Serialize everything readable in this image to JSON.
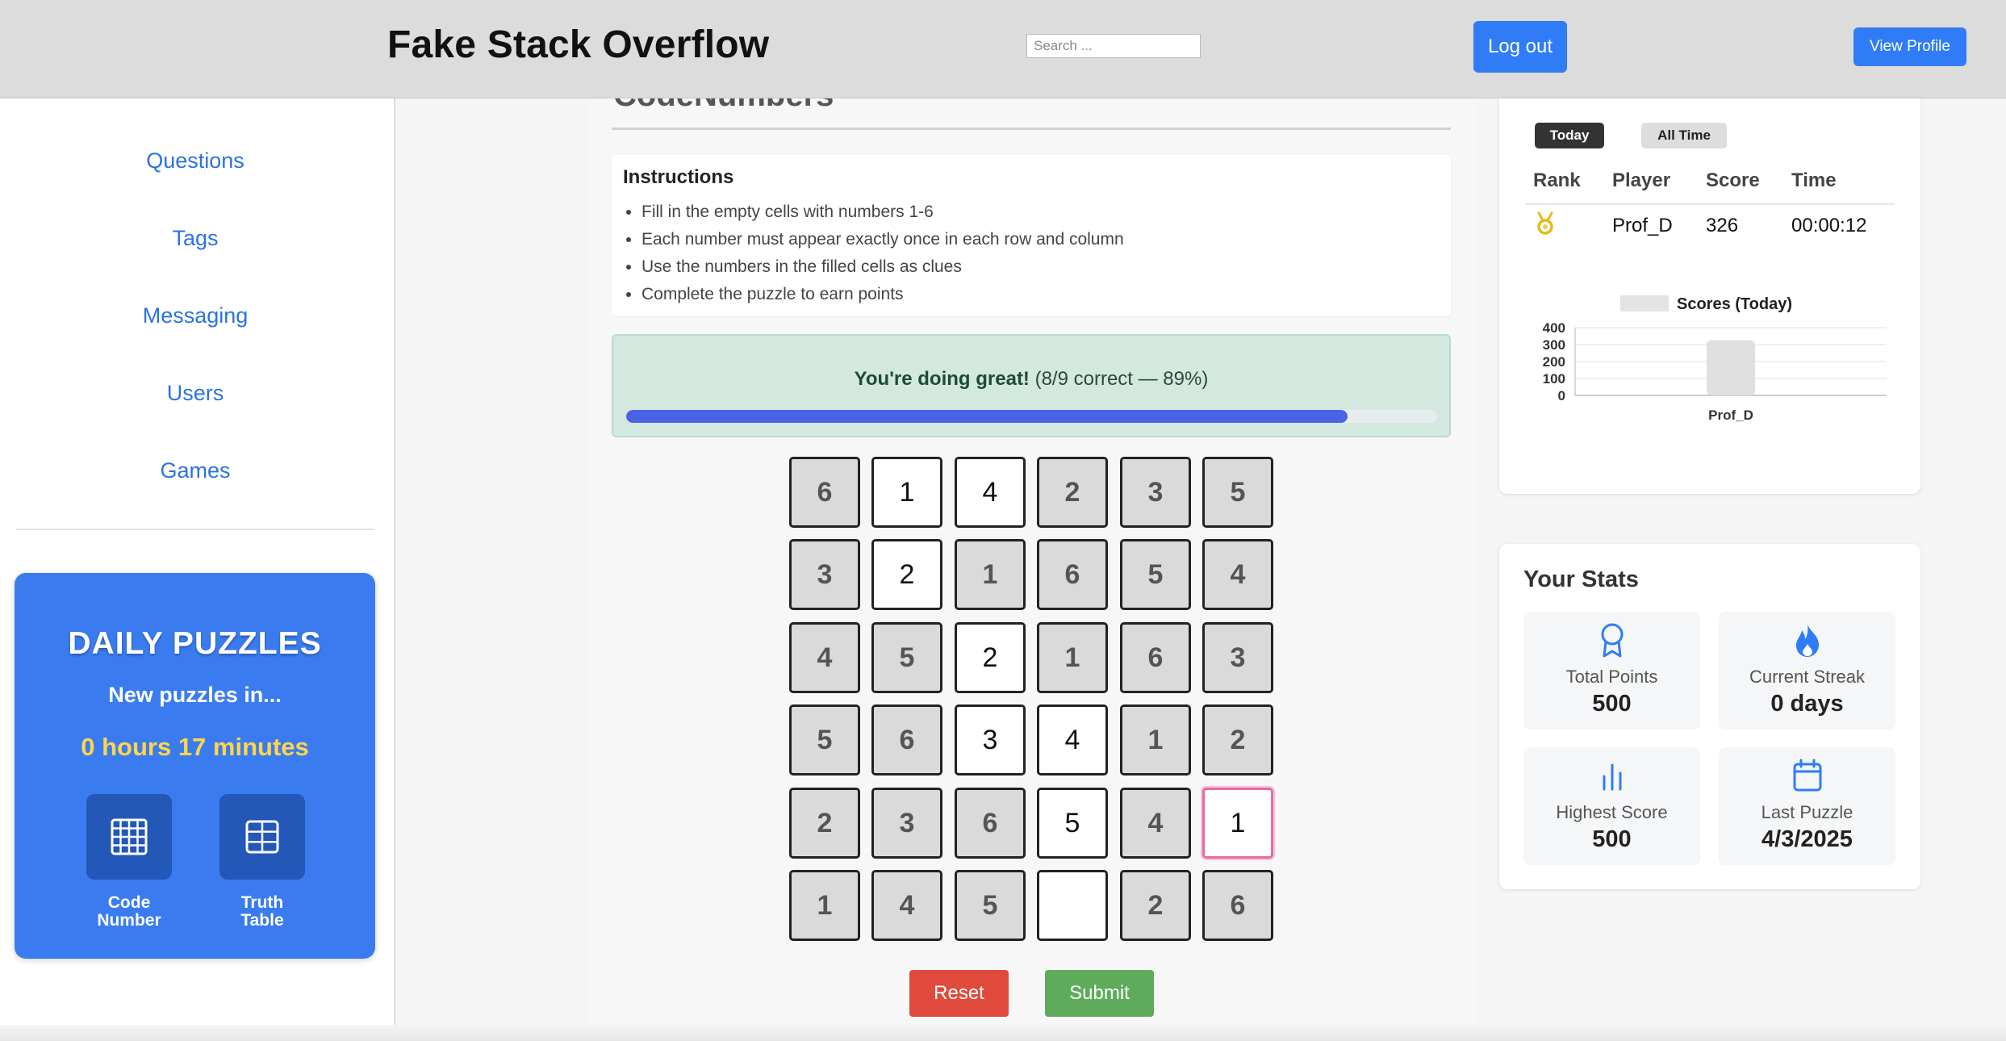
{
  "header": {
    "title": "Fake Stack Overflow",
    "search_placeholder": "Search ...",
    "logout_label": "Log out",
    "profile_label": "View Profile"
  },
  "sidebar": {
    "items": [
      {
        "label": "Questions"
      },
      {
        "label": "Tags"
      },
      {
        "label": "Messaging"
      },
      {
        "label": "Users"
      },
      {
        "label": "Games"
      }
    ],
    "daily": {
      "title": "DAILY PUZZLES",
      "subtitle": "New puzzles in...",
      "countdown": "0 hours 17 minutes",
      "puzzles": [
        {
          "line1": "Code",
          "line2": "Number",
          "icon": "grid-4x4-icon"
        },
        {
          "line1": "Truth",
          "line2": "Table",
          "icon": "table-icon"
        }
      ]
    }
  },
  "main": {
    "peek_title": "CodeNumbers",
    "instructions": {
      "heading": "Instructions",
      "items": [
        "Fill in the empty cells with numbers 1-6",
        "Each number must appear exactly once in each row and column",
        "Use the numbers in the filled cells as clues",
        "Complete the puzzle to earn points"
      ]
    },
    "progress": {
      "headline": "You're doing great!",
      "detail": "(8/9 correct — 89%)",
      "percent": 89
    },
    "grid": [
      [
        {
          "v": "6",
          "given": true
        },
        {
          "v": "1",
          "given": false
        },
        {
          "v": "4",
          "given": false
        },
        {
          "v": "2",
          "given": true
        },
        {
          "v": "3",
          "given": true
        },
        {
          "v": "5",
          "given": true
        }
      ],
      [
        {
          "v": "3",
          "given": true
        },
        {
          "v": "2",
          "given": false
        },
        {
          "v": "1",
          "given": true
        },
        {
          "v": "6",
          "given": true
        },
        {
          "v": "5",
          "given": true
        },
        {
          "v": "4",
          "given": true
        }
      ],
      [
        {
          "v": "4",
          "given": true
        },
        {
          "v": "5",
          "given": true
        },
        {
          "v": "2",
          "given": false
        },
        {
          "v": "1",
          "given": true
        },
        {
          "v": "6",
          "given": true
        },
        {
          "v": "3",
          "given": true
        }
      ],
      [
        {
          "v": "5",
          "given": true
        },
        {
          "v": "6",
          "given": true
        },
        {
          "v": "3",
          "given": false
        },
        {
          "v": "4",
          "given": false
        },
        {
          "v": "1",
          "given": true
        },
        {
          "v": "2",
          "given": true
        }
      ],
      [
        {
          "v": "2",
          "given": true
        },
        {
          "v": "3",
          "given": true
        },
        {
          "v": "6",
          "given": true
        },
        {
          "v": "5",
          "given": false
        },
        {
          "v": "4",
          "given": true
        },
        {
          "v": "1",
          "given": false,
          "selected": true
        }
      ],
      [
        {
          "v": "1",
          "given": true
        },
        {
          "v": "4",
          "given": true
        },
        {
          "v": "5",
          "given": true
        },
        {
          "v": "",
          "given": false
        },
        {
          "v": "2",
          "given": true
        },
        {
          "v": "6",
          "given": true
        }
      ]
    ],
    "reset_label": "Reset",
    "submit_label": "Submit"
  },
  "leaderboard": {
    "tabs": {
      "active": "Today",
      "inactive": "All Time"
    },
    "headers": {
      "rank": "Rank",
      "player": "Player",
      "score": "Score",
      "time": "Time"
    },
    "rows": [
      {
        "rank_icon": "gold-medal-icon",
        "player": "Prof_D",
        "score": "326",
        "time": "00:00:12"
      }
    ]
  },
  "chart_data": {
    "type": "bar",
    "title": "Scores (Today)",
    "categories": [
      "Prof_D"
    ],
    "values": [
      326
    ],
    "ylim": [
      0,
      400
    ],
    "yticks": [
      "400",
      "300",
      "200",
      "100",
      "0"
    ],
    "grid": true,
    "bar_color": "#e0e0e0"
  },
  "stats": {
    "title": "Your Stats",
    "items": [
      {
        "label": "Total Points",
        "value": "500",
        "icon": "award-icon"
      },
      {
        "label": "Current Streak",
        "value": "0 days",
        "icon": "flame-icon"
      },
      {
        "label": "Highest Score",
        "value": "500",
        "icon": "bar-chart-icon"
      },
      {
        "label": "Last Puzzle",
        "value": "4/3/2025",
        "icon": "calendar-icon"
      }
    ],
    "icon_color": "#2f7cf6"
  }
}
